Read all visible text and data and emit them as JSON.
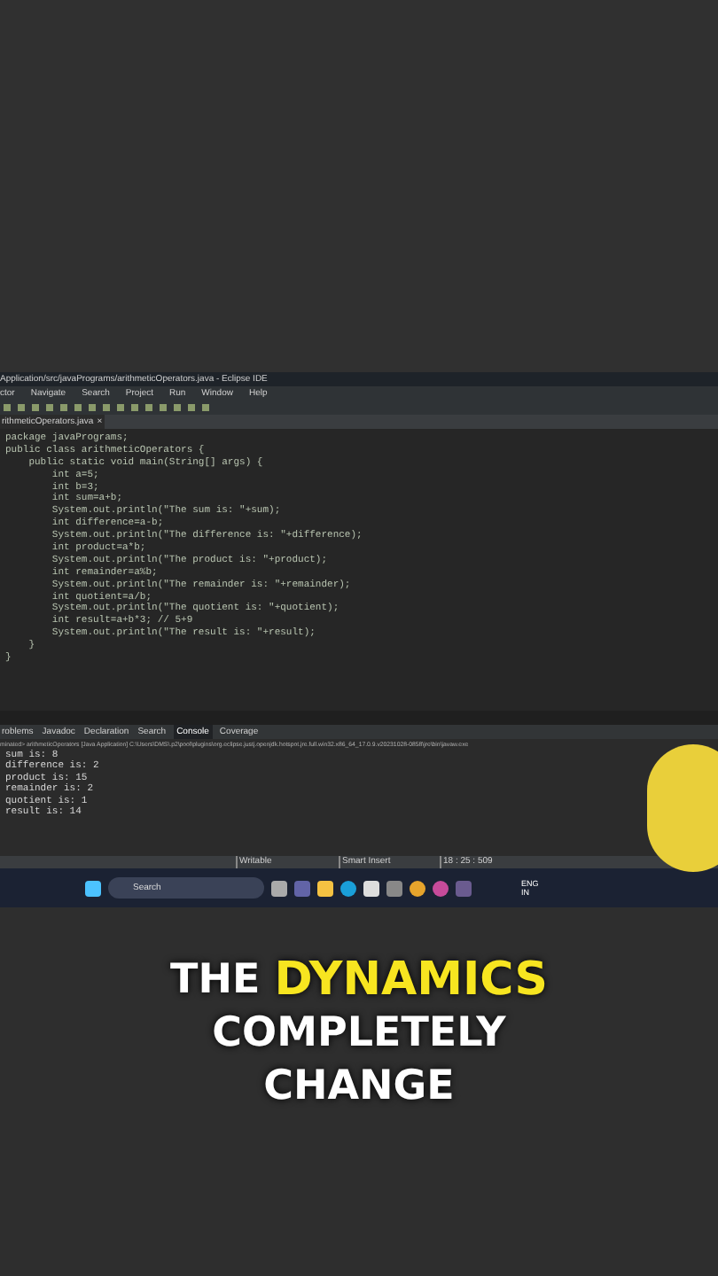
{
  "window": {
    "title": "Application/src/javaPrograms/arithmeticOperators.java - Eclipse IDE"
  },
  "menu": [
    "ctor",
    "Navigate",
    "Search",
    "Project",
    "Run",
    "Window",
    "Help"
  ],
  "editor_tab": {
    "label": "rithmeticOperators.java",
    "close": "×"
  },
  "code": [
    "package javaPrograms;",
    "public class arithmeticOperators {",
    "    public static void main(String[] args) {",
    "        int a=5;",
    "        int b=3;",
    "        int sum=a+b;",
    "        System.out.println(\"The sum is: \"+sum);",
    "        int difference=a-b;",
    "        System.out.println(\"The difference is: \"+difference);",
    "        int product=a*b;",
    "        System.out.println(\"The product is: \"+product);",
    "        int remainder=a%b;",
    "        System.out.println(\"The remainder is: \"+remainder);",
    "        int quotient=a/b;",
    "        System.out.println(\"The quotient is: \"+quotient);",
    "        int result=a+b*3; // 5+9",
    "        System.out.println(\"The result is: \"+result);",
    "    }",
    "}"
  ],
  "panel_tabs": [
    {
      "label": "roblems",
      "selected": false
    },
    {
      "label": "Javadoc",
      "selected": false
    },
    {
      "label": "Declaration",
      "selected": false
    },
    {
      "label": "Search",
      "selected": false
    },
    {
      "label": "Console",
      "selected": true
    },
    {
      "label": "Coverage",
      "selected": false
    }
  ],
  "console": {
    "header": "minated> arithmeticOperators [Java Application] C:\\Users\\DMS\\.p2\\pool\\plugins\\org.eclipse.justj.openjdk.hotspot.jre.full.win32.x86_64_17.0.9.v20231028-0858\\jre\\bin\\javaw.exe",
    "output": [
      "sum is: 8",
      "difference is: 2",
      "product is: 15",
      "remainder is: 2",
      "quotient is: 1",
      "result is: 14"
    ]
  },
  "status_bar": [
    "Writable",
    "Smart Insert",
    "18 : 25 : 509"
  ],
  "taskbar": {
    "search": "Search",
    "language": "ENG",
    "region": "IN"
  },
  "caption": [
    [
      {
        "text": "THE",
        "highlight": false
      },
      {
        "text": "DYNAMICS",
        "highlight": true
      }
    ],
    [
      {
        "text": "COMPLETELY",
        "highlight": false
      }
    ],
    [
      {
        "text": "CHANGE",
        "highlight": false
      }
    ]
  ]
}
